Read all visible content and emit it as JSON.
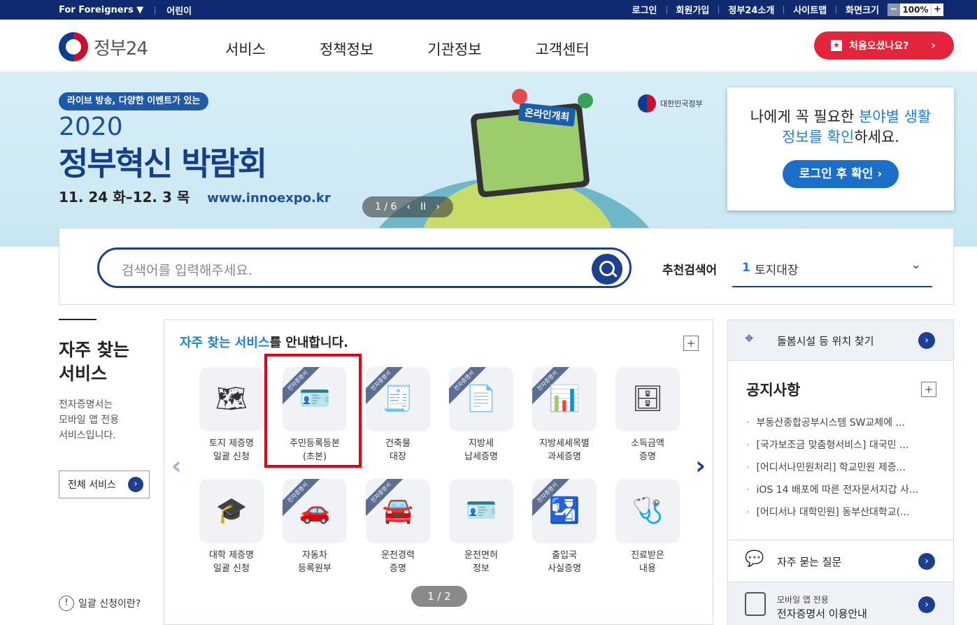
{
  "topbar": {
    "foreigners": "For Foreigners ▼",
    "kids": "어린이",
    "links": [
      "로그인",
      "회원가입",
      "정부24소개",
      "사이트맵",
      "화면크기"
    ],
    "zoom_minus": "−",
    "zoom_value": "100%",
    "zoom_plus": "+"
  },
  "header": {
    "logo_text": "정부24",
    "nav": [
      "서비스",
      "정책정보",
      "기관정보",
      "고객센터"
    ],
    "first_visit": "처음오셨나요?",
    "first_visit_arrow": "›"
  },
  "banner": {
    "pill": "라이브 방송, 다양한 이벤트가 있는",
    "year": "2020",
    "title": "정부혁신 박람회",
    "dates": "11. 24 화–12. 3 목",
    "url": "www.innoexpo.kr",
    "tag": "온라인개최",
    "gov_label": "대한민국정부",
    "counter": "1 / 6",
    "prev": "‹",
    "pause": "II",
    "next": "›"
  },
  "login_box": {
    "line1_a": "나에게 꼭 필요한 ",
    "line1_b": "분야별 생활",
    "line2_a": "정보를 확인",
    "line2_b": "하세요.",
    "button": "로그인 후 확인 ›"
  },
  "search": {
    "placeholder": "검색어를 입력해주세요.",
    "rec_label": "추천검색어",
    "rec_num": "1",
    "rec_value": "토지대장",
    "chevron": "⌄"
  },
  "left": {
    "title_line1": "자주 찾는",
    "title_line2": "서비스",
    "desc_line1": "전자증명서는",
    "desc_line2": "모바일 앱 전용",
    "desc_line3": "서비스입니다.",
    "all_services": "전체 서비스",
    "go": "›",
    "whatis_icon": "!",
    "whatis": "일괄 신청이란?"
  },
  "services": {
    "head_hl": "자주 찾는 서비스",
    "head_rest": "를 안내합니다.",
    "plus": "+",
    "arrow_prev": "‹",
    "arrow_next": "›",
    "ribbon": "전자증명서",
    "pager": "1 / 2",
    "tiles": [
      {
        "l1": "토지 제증명",
        "l2": "일괄 신청",
        "icon": "🗺",
        "ribbon": false
      },
      {
        "l1": "주민등록등본",
        "l2": "(초본)",
        "icon": "🪪",
        "ribbon": true
      },
      {
        "l1": "건축물",
        "l2": "대장",
        "icon": "🧾",
        "ribbon": true
      },
      {
        "l1": "지방세",
        "l2": "납세증명",
        "icon": "📄",
        "ribbon": true
      },
      {
        "l1": "지방세세목별",
        "l2": "과세증명",
        "icon": "📊",
        "ribbon": true
      },
      {
        "l1": "소득금액",
        "l2": "증명",
        "icon": "🗄",
        "ribbon": false
      },
      {
        "l1": "대학 제증명",
        "l2": "일괄 신청",
        "icon": "🎓",
        "ribbon": false
      },
      {
        "l1": "자동차",
        "l2": "등록원부",
        "icon": "🚗",
        "ribbon": true
      },
      {
        "l1": "운전경력",
        "l2": "증명",
        "icon": "🚘",
        "ribbon": true
      },
      {
        "l1": "운전면허",
        "l2": "정보",
        "icon": "🪪",
        "ribbon": false
      },
      {
        "l1": "출입국",
        "l2": "사실증명",
        "icon": "🛂",
        "ribbon": true
      },
      {
        "l1": "진료받은",
        "l2": "내용",
        "icon": "🩺",
        "ribbon": false
      }
    ]
  },
  "right": {
    "care": "돌봄시설 등 위치 찾기",
    "notice_title": "공지사항",
    "plus": "+",
    "go": "›",
    "notices": [
      "부동산종합공부시스템 SW교체에 ...",
      "[국가보조금 맞춤형서비스] 대국민 ...",
      "[어디서나민원처리] 학교민원 제증...",
      "iOS 14 배포에 따른 전자문서지갑 사...",
      "[어디서나 대학민원] 동부산대학교(..."
    ],
    "faq": "자주 묻는 질문",
    "mobile_line1": "모바일 앱 전용",
    "mobile_line2": "전자증명서 이용안내"
  },
  "colors": {
    "navy": "#0f2a6e",
    "accent_blue": "#1e7fd6",
    "red": "#e3243b",
    "highlight": "#e60012"
  }
}
